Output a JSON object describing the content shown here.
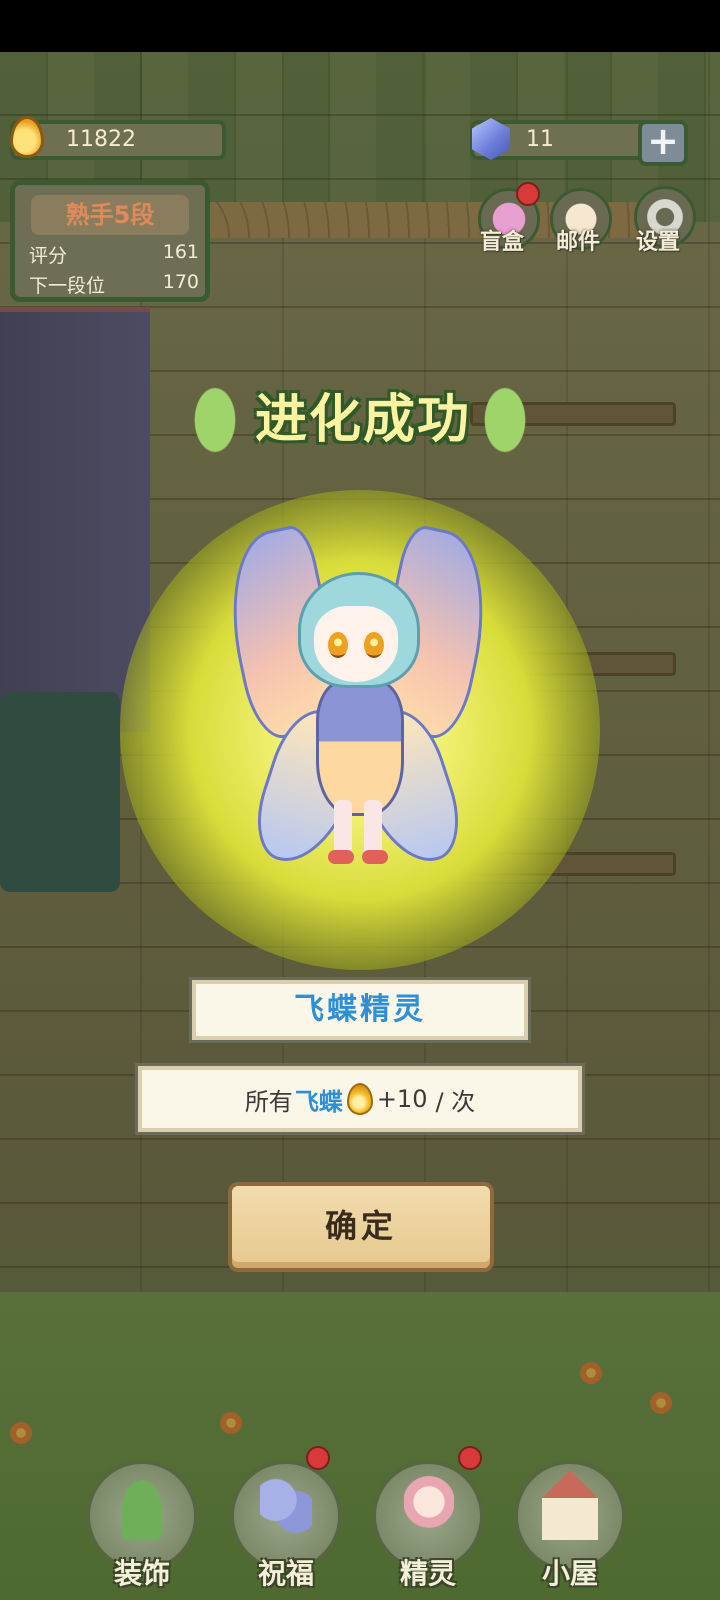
{
  "hud": {
    "coins": "11822",
    "gems": "11",
    "plus": "+"
  },
  "rank": {
    "title": "熟手5段",
    "score_label": "评分",
    "score_value": "161",
    "next_label": "下一段位",
    "next_value": "170"
  },
  "top_buttons": [
    {
      "label": "盲盒",
      "icon": "blind-box-icon",
      "badge": true
    },
    {
      "label": "邮件",
      "icon": "mail-icon",
      "badge": false
    },
    {
      "label": "设置",
      "icon": "gear-icon",
      "badge": false
    }
  ],
  "evolution": {
    "banner": "进化成功",
    "name": "飞蝶精灵",
    "bonus_prefix": "所有",
    "bonus_target": "飞蝶",
    "bonus_amount": "+10",
    "bonus_suffix": "/ 次",
    "confirm": "确定"
  },
  "nav": [
    {
      "label": "装饰",
      "icon": "plant-icon",
      "badge": false
    },
    {
      "label": "祝福",
      "icon": "butterfly-icon",
      "badge": true
    },
    {
      "label": "精灵",
      "icon": "fairy-icon",
      "badge": true
    },
    {
      "label": "小屋",
      "icon": "house-icon",
      "badge": false
    }
  ],
  "colors": {
    "accent_blue": "#2e8fd4",
    "panel_bg": "#fbf7e8",
    "button_bg": "#f2dcae",
    "badge_red": "#d83a3a",
    "frame_green": "#3c5a32"
  }
}
